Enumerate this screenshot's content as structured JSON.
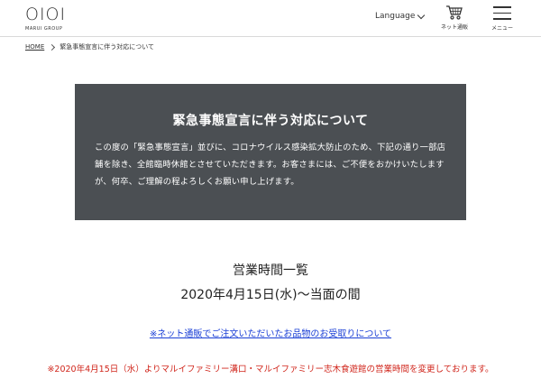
{
  "header": {
    "logo_mark": "OIOI",
    "logo_sub": "MARUI GROUP",
    "language_label": "Language",
    "cart_label": "ネット通販",
    "menu_label": "メニュー"
  },
  "breadcrumb": {
    "home": "HOME",
    "current": "緊急事態宣言に伴う対応について"
  },
  "notice": {
    "title": "緊急事態宣言に伴う対応について",
    "body": "この度の「緊急事態宣言」並びに、コロナウイルス感染拡大防止のため、下記の通り一部店舗を除き、全館臨時休館とさせていただきます。お客さまには、ご不便をおかけいたしますが、何卒、ご理解の程よろしくお願い申し上げます。"
  },
  "hours": {
    "title": "営業時間一覧",
    "date": "2020年4月15日(水)〜当面の間"
  },
  "links": {
    "order_link": "※ネット通販でご注文いただいたお品物のお受取りについて"
  },
  "notes": {
    "red": "※2020年4月15日（水）よりマルイファミリー溝口・マルイファミリー志木食遊館の営業時間を変更しております。"
  },
  "colors": {
    "notice_bg": "#4b4f53",
    "link": "#1a3fd6",
    "alert": "#d0251b"
  }
}
